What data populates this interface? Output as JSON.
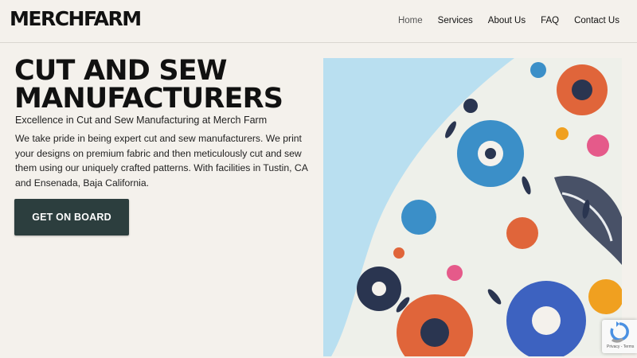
{
  "header": {
    "logo": "MERCHFARM",
    "nav": [
      {
        "label": "Home",
        "active": true
      },
      {
        "label": "Services"
      },
      {
        "label": "About Us"
      },
      {
        "label": "FAQ"
      },
      {
        "label": "Contact Us"
      }
    ]
  },
  "hero": {
    "title": "CUT AND SEW MANUFACTURERS",
    "subtitle": "Excellence in Cut and Sew Manufacturing at Merch Farm",
    "description": "We take pride in being expert cut and sew manufacturers. We print your designs on premium fabric and then meticulously cut and sew them using our uniquely crafted patterns. With facilities in Tustin, CA and Ensenada, Baja California.",
    "cta_label": "GET ON BOARD"
  },
  "recaptcha": {
    "links": "Privacy - Terms"
  },
  "colors": {
    "background": "#f4f1ec",
    "cta": "#2c3e3e",
    "sky": "#b9dff0",
    "fabric_orange": "#e0653a",
    "fabric_blue": "#3b8fc8",
    "fabric_navy": "#2a3550"
  }
}
